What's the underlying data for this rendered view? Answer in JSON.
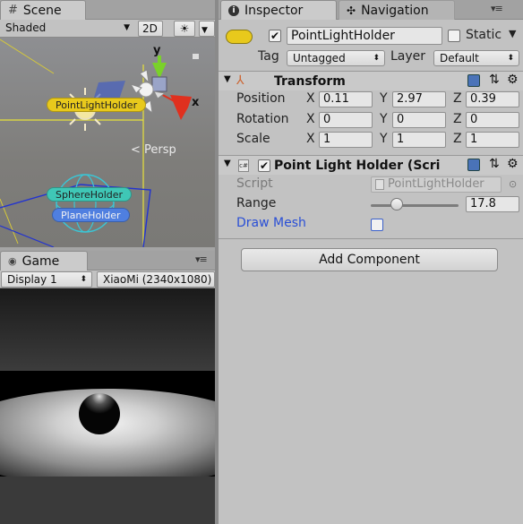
{
  "scene": {
    "tab_label": "Scene",
    "shading_mode": "Shaded",
    "mode_2d": "2D",
    "persp_label": "< Persp",
    "gizmo_axes": {
      "y": "y",
      "x": "x"
    },
    "objects": {
      "point_light": "PointLightHolder",
      "sphere": "SphereHolder",
      "plane": "PlaneHolder"
    }
  },
  "game": {
    "tab_label": "Game",
    "display": "Display 1",
    "resolution": "XiaoMi (2340x1080)"
  },
  "inspector": {
    "tab_label": "Inspector",
    "navigation_tab_label": "Navigation",
    "object_name": "PointLightHolder",
    "active": true,
    "static_label": "Static",
    "static_checked": false,
    "tag_label": "Tag",
    "tag_value": "Untagged",
    "layer_label": "Layer",
    "layer_value": "Default",
    "transform": {
      "title": "Transform",
      "position_label": "Position",
      "rotation_label": "Rotation",
      "scale_label": "Scale",
      "axis_x": "X",
      "axis_y": "Y",
      "axis_z": "Z",
      "position": {
        "x": "0.11",
        "y": "2.97",
        "z": "0.39"
      },
      "rotation": {
        "x": "0",
        "y": "0",
        "z": "0"
      },
      "scale": {
        "x": "1",
        "y": "1",
        "z": "1"
      }
    },
    "script_component": {
      "title": "Point Light Holder (Scrip",
      "enabled": true,
      "script_label": "Script",
      "script_value": "PointLightHolder",
      "range_label": "Range",
      "range_value": "17.8",
      "range_fraction": 0.3,
      "draw_mesh_label": "Draw Mesh",
      "draw_mesh_checked": false
    },
    "add_component_label": "Add Component"
  },
  "colors": {
    "light_tag": "#e8c91c",
    "sphere_tag": "#3fc7b6",
    "plane_tag": "#4f7fe0",
    "gizmo_y": "#7ad12a",
    "gizmo_x": "#e0301e",
    "link_blue": "#2a4fd6"
  }
}
